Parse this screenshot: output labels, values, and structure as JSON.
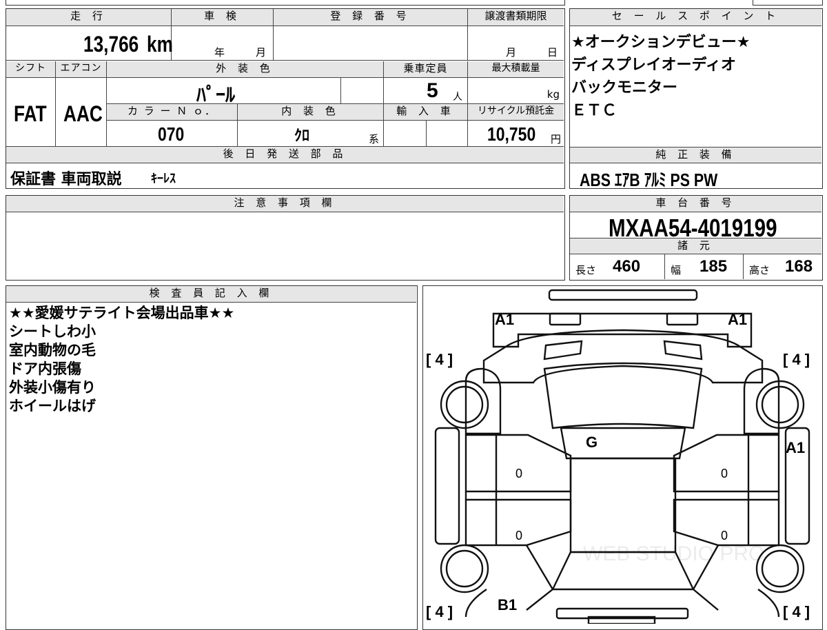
{
  "mileage": {
    "label": "走 行",
    "value": "13,766",
    "unit": "km"
  },
  "inspection": {
    "label": "車 検",
    "year_label": "年",
    "month_label": "月"
  },
  "registration": {
    "label": "登 録 番 号"
  },
  "transfer_deadline": {
    "label": "譲渡書類期限",
    "month_label": "月",
    "day_label": "日"
  },
  "sales_points": {
    "label": "セ ー ル ス ポ イ ン ト",
    "items": [
      "★オークションデビュー★",
      "ディスプレイオーディオ",
      "バックモニター",
      "ＥＴＣ"
    ]
  },
  "shift": {
    "label": "シフト",
    "value": "FAT"
  },
  "aircon": {
    "label": "エアコン",
    "value": "AAC"
  },
  "exterior_color": {
    "label": "外 装 色",
    "value": "ﾊﾟｰﾙ"
  },
  "capacity": {
    "label": "乗車定員",
    "value": "5",
    "unit": "人"
  },
  "max_load": {
    "label": "最大積載量",
    "unit": "kg"
  },
  "color_no": {
    "label": "カ ラ ー Ｎ ｏ．",
    "value": "070"
  },
  "interior_color": {
    "label": "内 装 色",
    "value": "ｸﾛ",
    "suffix": "系"
  },
  "import_car": {
    "label": "輸 入 車"
  },
  "recycle_deposit": {
    "label": "リサイクル預託金",
    "value": "10,750",
    "unit": "円"
  },
  "later_shipping": {
    "label": "後 日 発 送 部 品",
    "value_a": "保証書 車両取説",
    "value_b": "ｷｰﾚｽ"
  },
  "equipment": {
    "label": "純 正 装 備",
    "value": "ABS ｴｱB ｱﾙﾐ PS PW"
  },
  "notes": {
    "label": "注 意 事 項 欄"
  },
  "chassis": {
    "label": "車 台 番 号",
    "value": "MXAA54-4019199"
  },
  "specs": {
    "label": "諸 元",
    "length_label": "長さ",
    "length": "460",
    "width_label": "幅",
    "width": "185",
    "height_label": "高さ",
    "height": "168"
  },
  "inspector": {
    "label": "検 査 員 記 入 欄",
    "lines": [
      "★★愛媛サテライト会場出品車★★",
      "シートしわ小",
      "室内動物の毛",
      "ドア内張傷",
      "外装小傷有り",
      "ホイールはげ"
    ]
  },
  "diagram": {
    "marks": {
      "front_left": "A1",
      "front_right": "A1",
      "tire_fl": "[ 4 ]",
      "tire_fr": "[ 4 ]",
      "tire_rl": "[ 4 ]",
      "tire_rr": "[ 4 ]",
      "windshield": "G",
      "right_side": "A1",
      "rear_left": "B1",
      "door_fl": "0",
      "door_rl": "0",
      "door_fr": "0",
      "door_rr": "0"
    },
    "watermark": "WEB STUDIO PRO"
  }
}
